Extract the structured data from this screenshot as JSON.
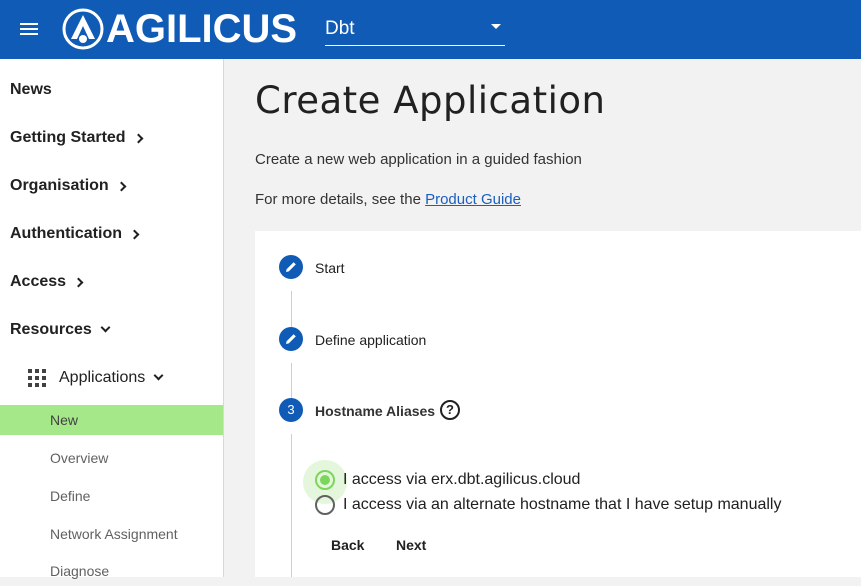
{
  "header": {
    "brand": "AGILICUS",
    "org_select_value": "Dbt",
    "menu_icon": "hamburger-menu-icon",
    "colors": {
      "header": "#0f5bb5",
      "active_nav": "#a5e889",
      "radio_checked": "#7cd65c"
    }
  },
  "sidebar": {
    "news": "News",
    "getting_started": "Getting Started",
    "organisation": "Organisation",
    "authentication": "Authentication",
    "access": "Access",
    "resources": "Resources",
    "applications": "Applications",
    "sub_items": [
      "New",
      "Overview",
      "Define",
      "Network Assignment",
      "Diagnose"
    ]
  },
  "main": {
    "title": "Create Application",
    "description": "Create a new web application in a guided fashion",
    "more_prefix": "For more details, see the ",
    "more_link": "Product Guide",
    "steps": [
      {
        "label": "Start",
        "icon": "edit-pencil-icon"
      },
      {
        "label": "Define application",
        "icon": "edit-pencil-icon"
      },
      {
        "label": "Hostname Aliases",
        "number": "3"
      }
    ],
    "help_icon": "help-circle-icon",
    "options": [
      {
        "label": "I access via erx.dbt.agilicus.cloud",
        "checked": true
      },
      {
        "label": "I access via an alternate hostname that I have setup manually",
        "checked": false
      }
    ],
    "back_label": "Back",
    "next_label": "Next"
  }
}
